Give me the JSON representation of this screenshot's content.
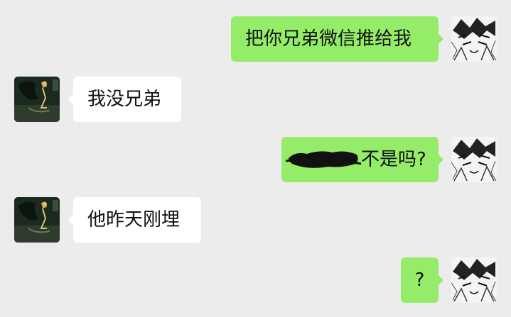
{
  "messages": [
    {
      "side": "out",
      "text": "把你兄弟微信推给我"
    },
    {
      "side": "in",
      "text": "我没兄弟"
    },
    {
      "side": "out",
      "redacted": true,
      "text": "不是吗?"
    },
    {
      "side": "in",
      "text": "他昨天刚埋"
    },
    {
      "side": "out",
      "text": "?"
    }
  ],
  "colors": {
    "background": "#ececec",
    "outgoing_bubble": "#95ec69",
    "incoming_bubble": "#ffffff"
  },
  "icons": {
    "self_avatar": "manga-avatar-icon",
    "contact_avatar": "dark-illustration-avatar-icon",
    "redaction": "black-scribble-redaction"
  }
}
